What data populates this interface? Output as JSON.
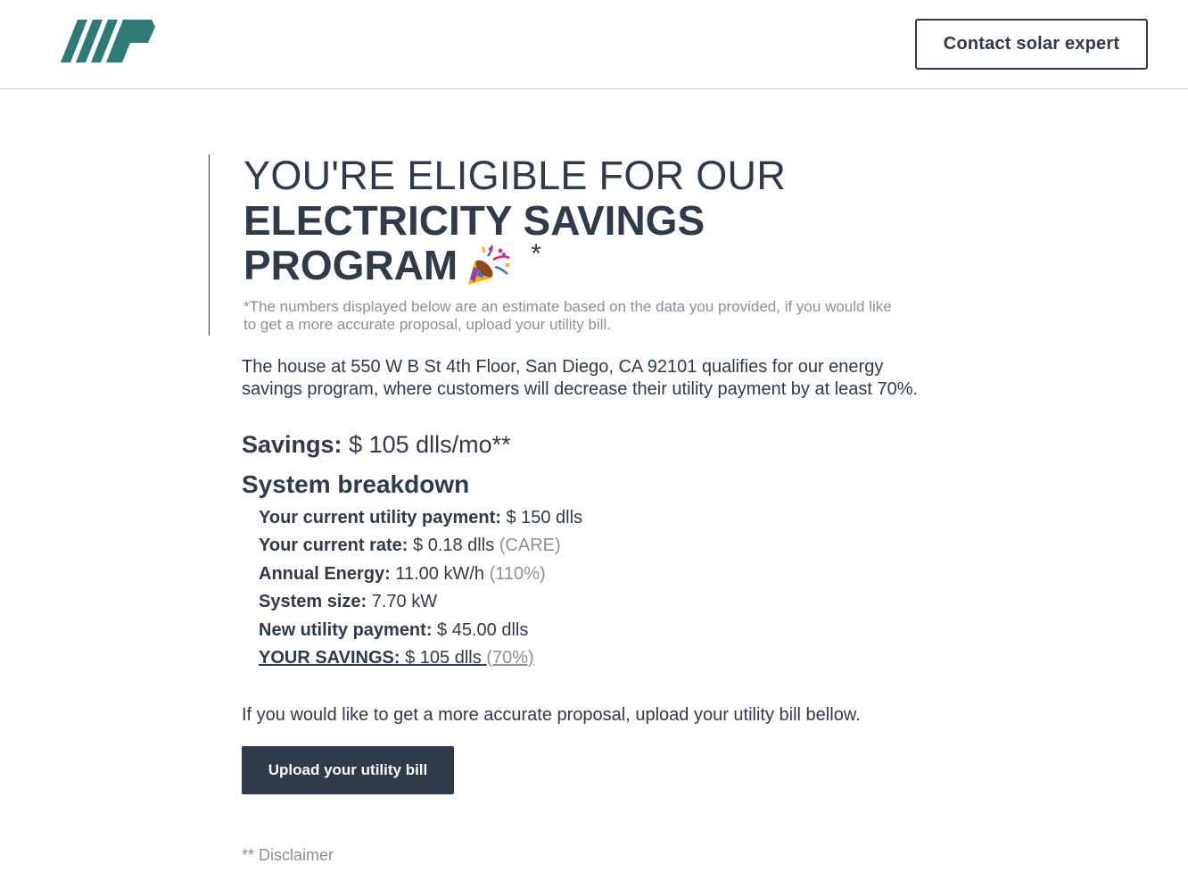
{
  "header": {
    "logo_icon": "company-logo",
    "contact_label": "Contact solar expert"
  },
  "colors": {
    "text": "#2f3a4b",
    "muted": "#8a8f98",
    "logo": "#2e7a76",
    "button": "#2f3a4b"
  },
  "hero": {
    "line1": "YOU'RE ELIGIBLE FOR OUR",
    "line2": "ELECTRICITY SAVINGS",
    "line3": "PROGRAM",
    "emoji_icon": "party-popper-icon",
    "asterisk": "*",
    "note": "*The numbers displayed below are an estimate based on the data you provided, if you would like to get a more accurate proposal, upload your utility bill."
  },
  "intro": "The house at 550 W B St 4th Floor, San Diego, CA 92101 qualifies for our energy savings program, where customers will decrease their utility payment by at least 70%.",
  "savings": {
    "label": "Savings:",
    "value": "$ 105 dlls/mo**"
  },
  "breakdown": {
    "title": "System breakdown",
    "rows": [
      {
        "label": "Your current utility payment:",
        "value": "$ 150 dlls",
        "extra": ""
      },
      {
        "label": "Your current rate:",
        "value": "$ 0.18 dlls",
        "extra": "(CARE)"
      },
      {
        "label": "Annual Energy:",
        "value": "11.00 kW/h",
        "extra": "(110%)"
      },
      {
        "label": "System size:",
        "value": "7.70 kW",
        "extra": ""
      },
      {
        "label": "New utility payment:",
        "value": "$ 45.00 dlls",
        "extra": ""
      },
      {
        "label": "YOUR SAVINGS:",
        "value": "$ 105 dlls",
        "extra": "(70%)"
      }
    ]
  },
  "cta": {
    "text": "If you would like to get a more accurate proposal, upload your utility bill bellow.",
    "button_label": "Upload your utility bill"
  },
  "disclaimer": "** Disclaimer"
}
